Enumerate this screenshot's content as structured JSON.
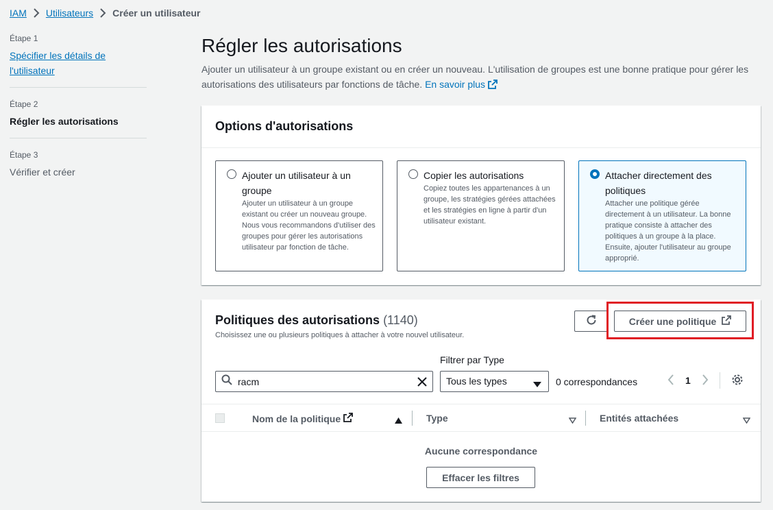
{
  "breadcrumb": {
    "items": [
      "IAM",
      "Utilisateurs"
    ],
    "current": "Créer un utilisateur"
  },
  "steps": [
    {
      "num": "Étape 1",
      "title": "Spécifier les détails de l'utilisateur"
    },
    {
      "num": "Étape 2",
      "title": "Régler les autorisations"
    },
    {
      "num": "Étape 3",
      "title": "Vérifier et créer"
    }
  ],
  "page": {
    "title": "Régler les autorisations",
    "description": "Ajouter un utilisateur à un groupe existant ou en créer un nouveau. L'utilisation de groupes est une bonne pratique pour gérer les autorisations des utilisateurs par fonctions de tâche.",
    "learn_more": "En savoir plus"
  },
  "options": {
    "title": "Options d'autorisations",
    "tiles": [
      {
        "title": "Ajouter un utilisateur à un groupe",
        "desc": "Ajouter un utilisateur à un groupe existant ou créer un nouveau groupe. Nous vous recommandons d'utiliser des groupes pour gérer les autorisations utilisateur par fonction de tâche."
      },
      {
        "title": "Copier les autorisations",
        "desc": "Copiez toutes les appartenances à un groupe, les stratégies gérées attachées et les stratégies en ligne à partir d'un utilisateur existant."
      },
      {
        "title": "Attacher directement des politiques",
        "desc": "Attacher une politique gérée directement à un utilisateur. La bonne pratique consiste à attacher des politiques à un groupe à la place. Ensuite, ajouter l'utilisateur au groupe approprié."
      }
    ],
    "selected_index": 2
  },
  "policies": {
    "title": "Politiques des autorisations",
    "count": "(1140)",
    "description": "Choisissez une ou plusieurs politiques à attacher à votre nouvel utilisateur.",
    "create_button": "Créer une politique",
    "filter_label": "Filtrer par Type",
    "search_value": "racm",
    "type_select": "Tous les types",
    "matches": "0 correspondances",
    "page": "1",
    "columns": [
      "Nom de la politique",
      "Type",
      "Entités attachées"
    ],
    "empty": "Aucune correspondance",
    "clear_filters": "Effacer les filtres"
  },
  "colors": {
    "link": "#0073bb",
    "highlight": "#e01b24",
    "selected_bg": "#f1faff"
  }
}
